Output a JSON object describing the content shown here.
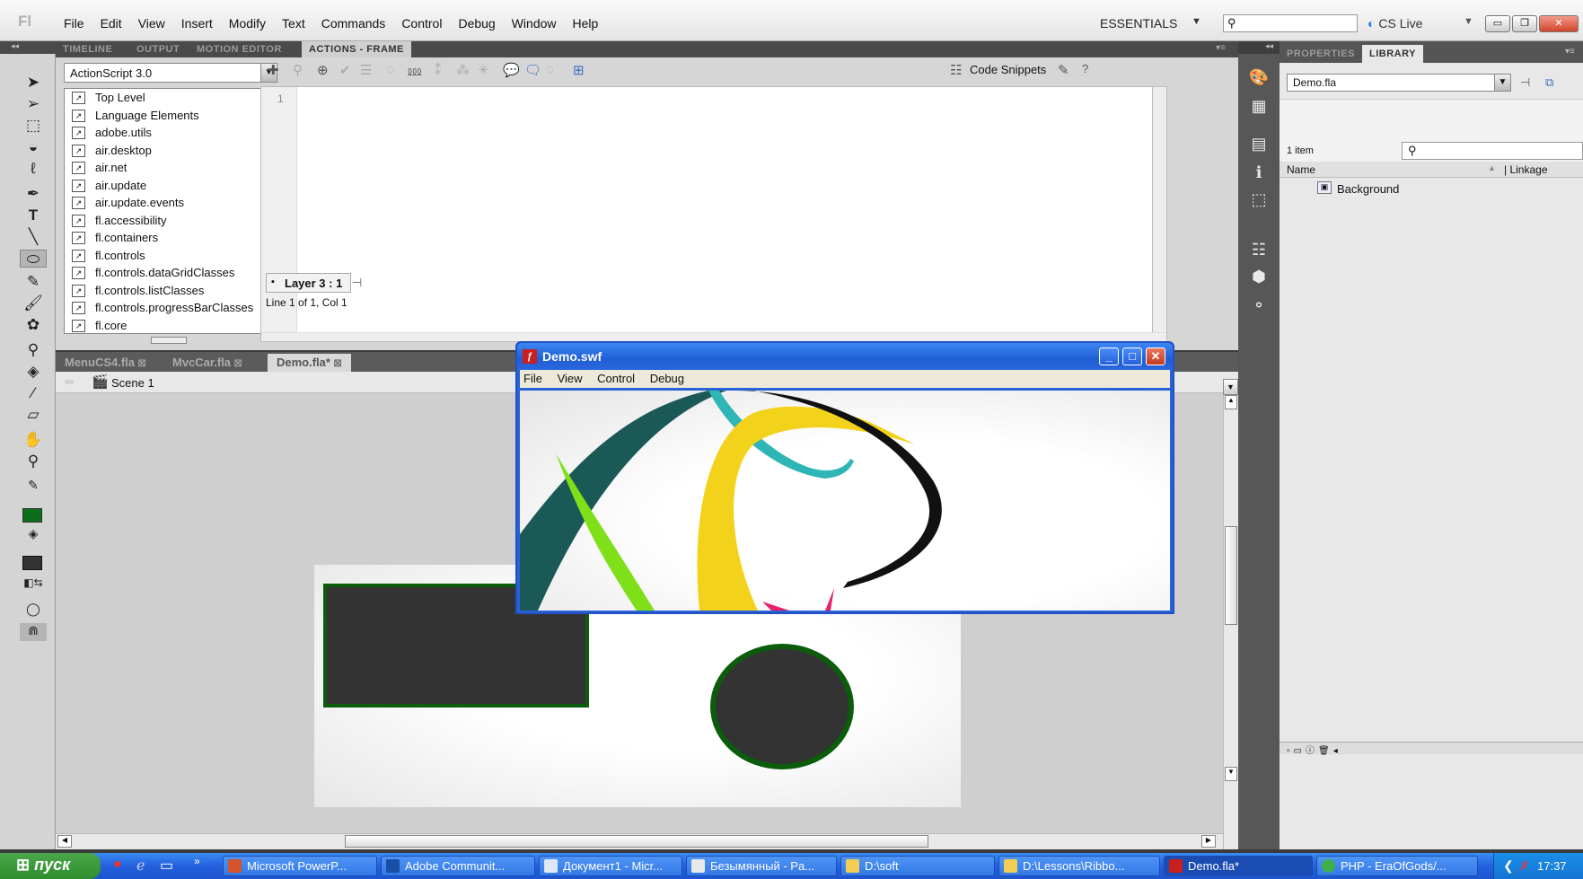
{
  "menubar": {
    "logo": "Fl",
    "items": [
      "File",
      "Edit",
      "View",
      "Insert",
      "Modify",
      "Text",
      "Commands",
      "Control",
      "Debug",
      "Window",
      "Help"
    ],
    "workspace": "ESSENTIALS",
    "search_placeholder": "",
    "cs_live": "CS Live"
  },
  "top_panel": {
    "tabs": [
      "TIMELINE",
      "OUTPUT",
      "MOTION EDITOR",
      "ACTIONS - FRAME"
    ],
    "active_tab": "ACTIONS - FRAME",
    "language": "ActionScript 3.0",
    "code_snippets": "Code Snippets",
    "tree": [
      "Top Level",
      "Language Elements",
      "adobe.utils",
      "air.desktop",
      "air.net",
      "air.update",
      "air.update.events",
      "fl.accessibility",
      "fl.containers",
      "fl.controls",
      "fl.controls.dataGridClasses",
      "fl.controls.listClasses",
      "fl.controls.progressBarClasses",
      "fl.core"
    ],
    "line_number": "1",
    "layer_tab": "Layer 3 : 1",
    "status": "Line 1 of 1, Col 1"
  },
  "documents": {
    "tabs": [
      "MenuCS4.fla",
      "MvcCar.fla",
      "Demo.fla*"
    ],
    "active": "Demo.fla*",
    "scene": "Scene 1"
  },
  "swf_window": {
    "title": "Demo.swf",
    "menus": [
      "File",
      "View",
      "Control",
      "Debug"
    ]
  },
  "library": {
    "tabs": [
      "PROPERTIES",
      "LIBRARY"
    ],
    "active": "LIBRARY",
    "document": "Demo.fla",
    "count": "1 item",
    "columns": [
      "Name",
      "Linkage"
    ],
    "items": [
      "Background"
    ]
  },
  "taskbar": {
    "start": "пуск",
    "tasks": [
      "Microsoft PowerP...",
      "Adobe Communit...",
      "Документ1 - Micr...",
      "Безымянный - Pa...",
      "D:\\soft",
      "D:\\Lessons\\Ribbo...",
      "Demo.fla*",
      "PHP - EraOfGods/..."
    ],
    "active_task": "Demo.fla*",
    "clock": "17:37"
  },
  "colors": {
    "stage_fill": "#333333",
    "stage_stroke": "#0b5c0b",
    "fill_swatch": "#0b6e1b",
    "stroke_swatch": "#333333"
  }
}
